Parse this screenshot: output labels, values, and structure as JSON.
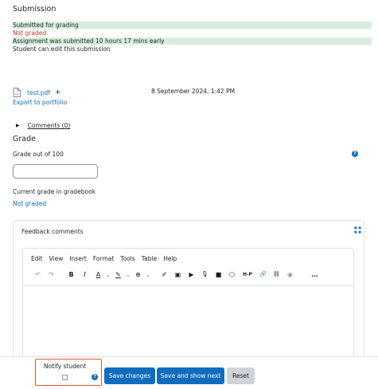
{
  "submission": {
    "title": "Submission",
    "status_submitted": "Submitted for grading",
    "status_grading": "Not graded",
    "time_status": "Assignment was submitted 10 hours 17 mins early",
    "edit_status": "Student can edit this submission",
    "file_name": "test.pdf",
    "file_add": "+",
    "file_date": "8 September 2024, 1:42 PM",
    "export_link": "Export to portfolio",
    "comments_link": "Comments (0)"
  },
  "grade": {
    "title": "Grade",
    "grade_out_of": "Grade out of 100",
    "grade_value": "",
    "current_grade_label": "Current grade in gradebook",
    "current_grade_value": "Not graded"
  },
  "feedback": {
    "title": "Feedback comments",
    "menu": [
      "Edit",
      "View",
      "Insert",
      "Format",
      "Tools",
      "Table",
      "Help"
    ],
    "toolbar_icons": [
      "undo-icon",
      "redo-icon",
      "bold-icon",
      "italic-icon",
      "text-color-icon",
      "highlight-icon",
      "link-world-icon",
      "brush-icon",
      "image-icon",
      "media-icon",
      "microphone-icon",
      "video-icon",
      "h5p-cube-icon",
      "h5p-icon",
      "link-icon",
      "unlink-icon",
      "accessibility-icon",
      "more-icon"
    ],
    "toolbar_glyphs": {
      "undo": "↶",
      "redo": "↷",
      "bold": "B",
      "italic": "I",
      "text_color": "A",
      "dropdown": "⌄",
      "highlight": "✎",
      "world": "⊕",
      "brush": "✐",
      "image": "▣",
      "media": "▶",
      "mic": "🎙",
      "video": "■",
      "cube": "⬡",
      "h5p": "H-P",
      "link": "🔗",
      "unlink": "⛓",
      "eye": "◉",
      "more": "…"
    }
  },
  "footer": {
    "notify_label": "Notify student",
    "save_changes": "Save changes",
    "save_and_show_next": "Save and show next",
    "reset": "Reset"
  },
  "icons": {
    "help": "?",
    "expand": "⤧",
    "caret": "▶"
  },
  "colors": {
    "accent": "#0f6cbf",
    "success_bg": "#d7eedc",
    "danger_text": "#ca3120",
    "highlight_border": "#e8572c"
  }
}
